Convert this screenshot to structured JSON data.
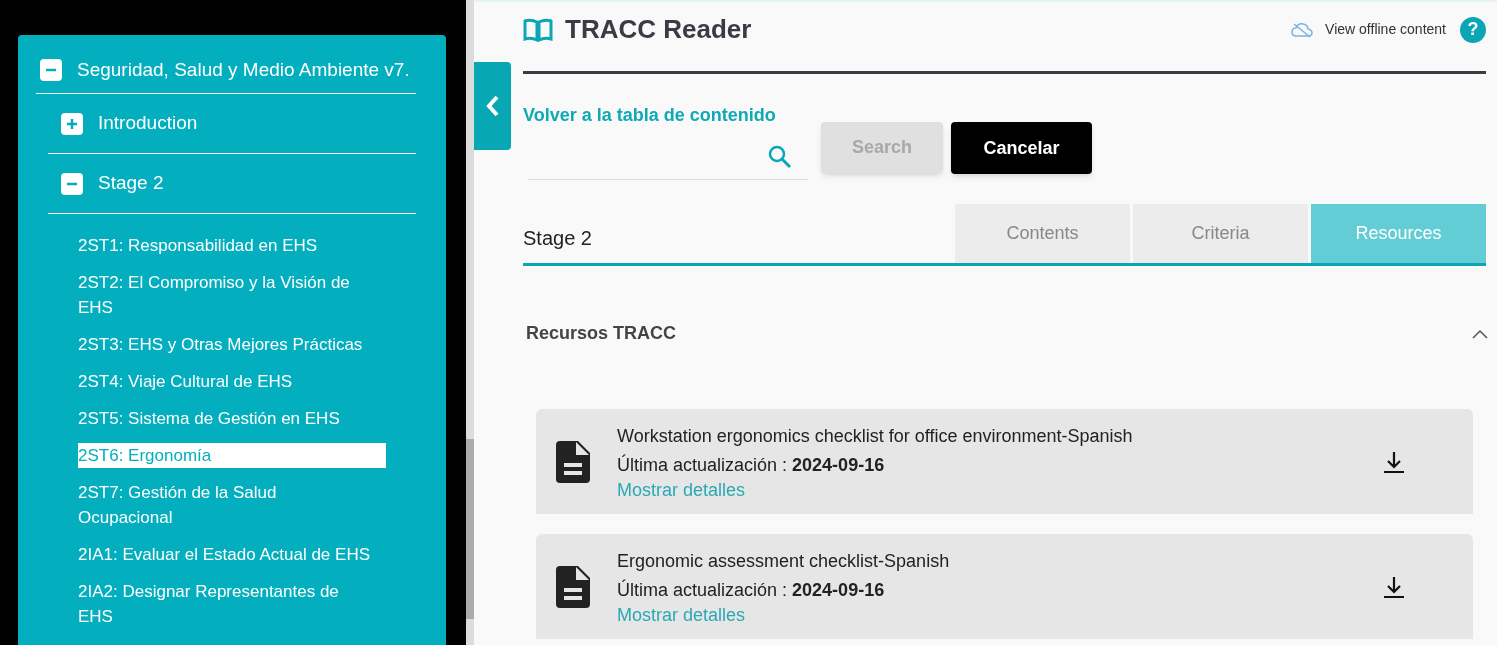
{
  "sidebar": {
    "tree": [
      {
        "label": "Seguridad, Salud y Medio Ambiente v7.",
        "expanded": true,
        "children": [
          {
            "label": "Introduction",
            "expanded": false
          },
          {
            "label": "Stage 2",
            "expanded": true,
            "children": [
              {
                "label": "2ST1: Responsabilidad en EHS",
                "selected": false
              },
              {
                "label": "2ST2: El Compromiso y la Visión de EHS",
                "selected": false
              },
              {
                "label": "2ST3: EHS y Otras Mejores Prácticas",
                "selected": false
              },
              {
                "label": "2ST4: Viaje Cultural de EHS",
                "selected": false
              },
              {
                "label": "2ST5: Sistema de Gestión en EHS",
                "selected": false
              },
              {
                "label": "2ST6: Ergonomía",
                "selected": true
              },
              {
                "label": "2ST7: Gestión de la Salud Ocupacional",
                "selected": false
              },
              {
                "label": "2IA1: Evaluar el Estado Actual de EHS",
                "selected": false
              },
              {
                "label": "2IA2: Designar Representantes de EHS",
                "selected": false
              }
            ]
          }
        ]
      }
    ]
  },
  "header": {
    "title": "TRACC Reader",
    "offline_link": "View offline content",
    "help": "?"
  },
  "back_link": "Volver a la tabla de contenido",
  "search": {
    "button": "Search",
    "button_disabled": true,
    "cancel": "Cancelar"
  },
  "stage_title": "Stage 2",
  "tabs": [
    {
      "label": "Contents",
      "selected": false
    },
    {
      "label": "Criteria",
      "selected": false
    },
    {
      "label": "Resources",
      "selected": true
    }
  ],
  "section": {
    "title": "Recursos TRACC",
    "expanded": true,
    "resources": [
      {
        "title": "Workstation ergonomics checklist for office environment-Spanish",
        "updated_label": "Última actualización :",
        "updated_date": "2024-09-16",
        "details_link": "Mostrar detalles"
      },
      {
        "title": "Ergonomic assessment checklist-Spanish",
        "updated_label": "Última actualización :",
        "updated_date": "2024-09-16",
        "details_link": "Mostrar detalles"
      }
    ]
  }
}
